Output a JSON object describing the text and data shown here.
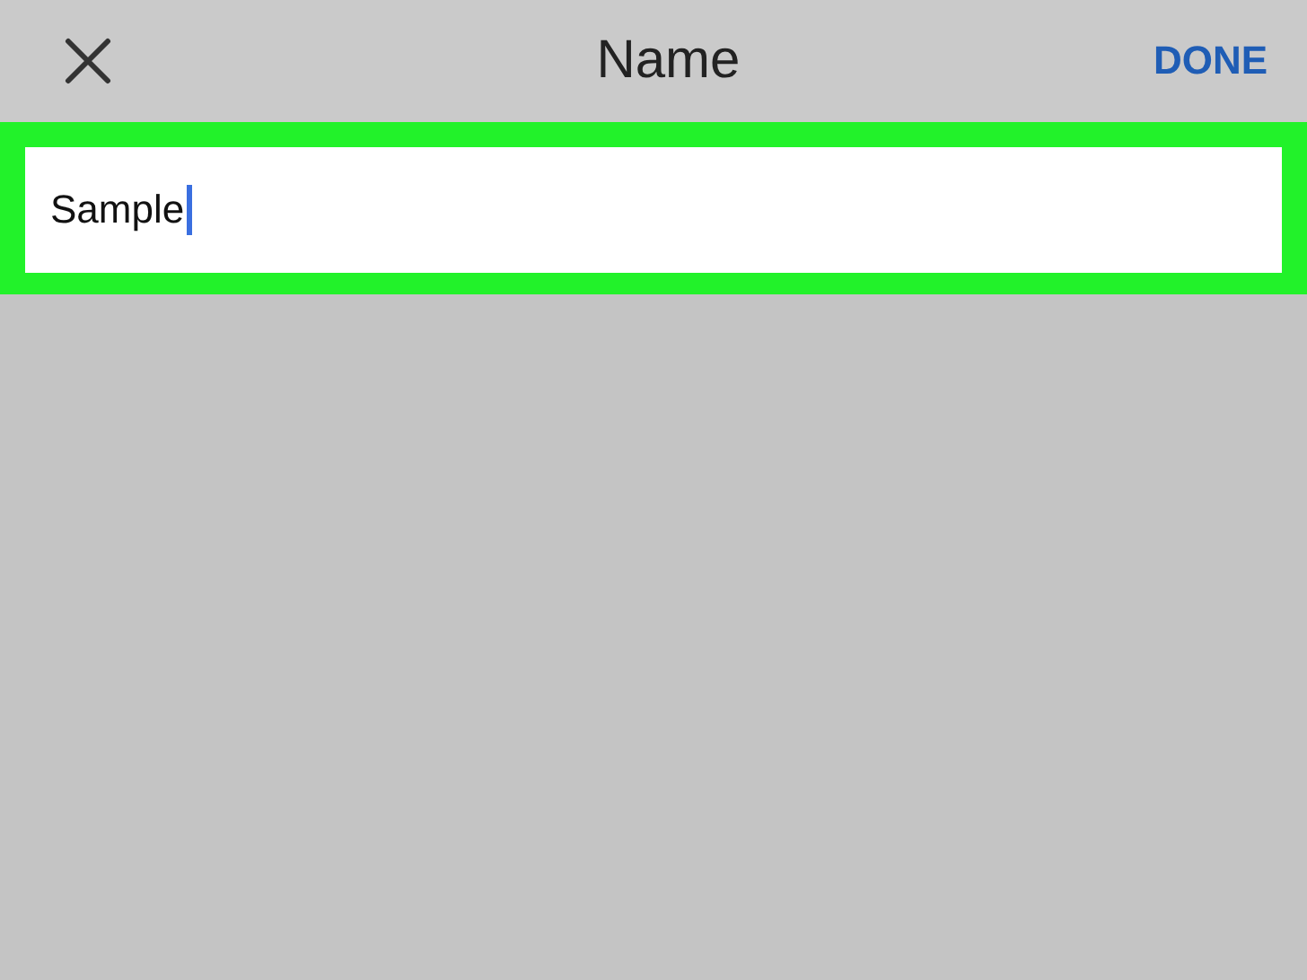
{
  "header": {
    "title": "Name",
    "done_label": "DONE"
  },
  "name_field": {
    "value": "Sample",
    "focused": true,
    "highlighted": true
  }
}
